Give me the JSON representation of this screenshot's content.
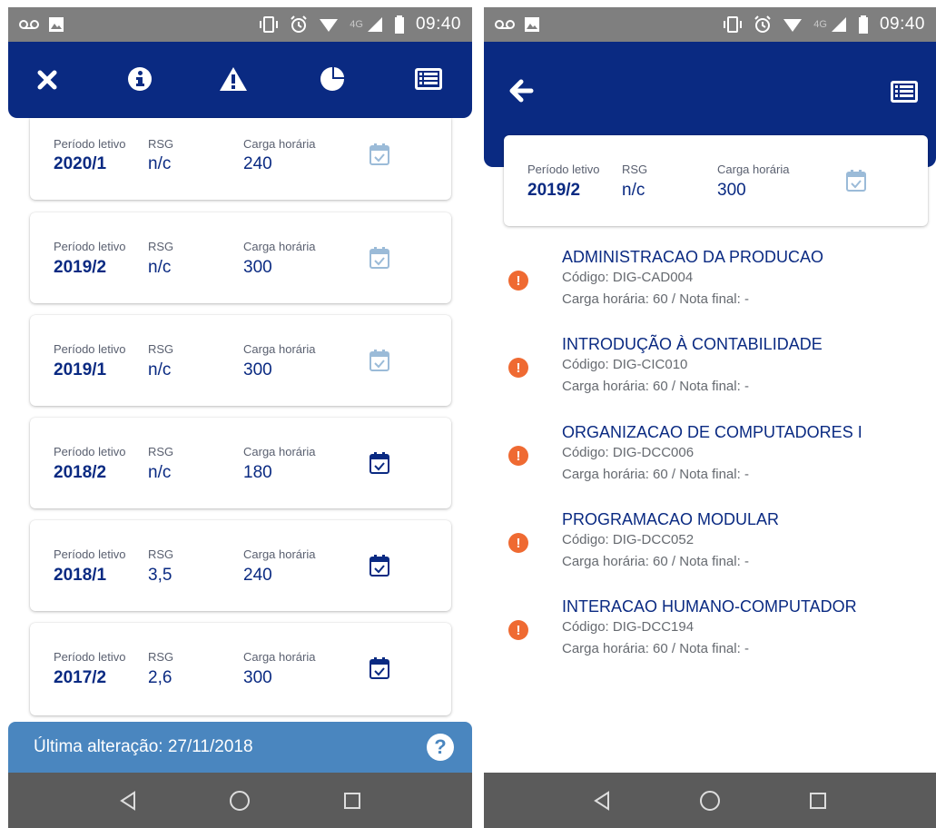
{
  "status_bar": {
    "time": "09:40",
    "network": "4G"
  },
  "colors": {
    "primary": "#0a2a82",
    "footer": "#4a86bf",
    "warning": "#ef6a32",
    "calendar_active": "#0a2a82",
    "calendar_inactive": "#9bbbd8"
  },
  "left_screen": {
    "toolbar": {
      "icons": [
        "close-icon",
        "info-icon",
        "warning-icon",
        "pie-chart-icon",
        "list-icon"
      ]
    },
    "labels": {
      "period": "Período letivo",
      "rsg": "RSG",
      "hours": "Carga horária"
    },
    "periods": [
      {
        "period": "2020/1",
        "rsg": "n/c",
        "hours": "240",
        "calendar_state": "inactive"
      },
      {
        "period": "2019/2",
        "rsg": "n/c",
        "hours": "300",
        "calendar_state": "inactive"
      },
      {
        "period": "2019/1",
        "rsg": "n/c",
        "hours": "300",
        "calendar_state": "inactive"
      },
      {
        "period": "2018/2",
        "rsg": "n/c",
        "hours": "180",
        "calendar_state": "active"
      },
      {
        "period": "2018/1",
        "rsg": "3,5",
        "hours": "240",
        "calendar_state": "active"
      },
      {
        "period": "2017/2",
        "rsg": "2,6",
        "hours": "300",
        "calendar_state": "active"
      }
    ],
    "footer": {
      "last_change": "Última alteração: 27/11/2018",
      "help_icon": "help-icon"
    }
  },
  "right_screen": {
    "toolbar": {
      "icons": [
        "back-arrow-icon",
        "list-icon"
      ]
    },
    "summary": {
      "period_label": "Período letivo",
      "period": "2019/2",
      "rsg_label": "RSG",
      "rsg": "n/c",
      "hours_label": "Carga horária",
      "hours": "300"
    },
    "subjects": [
      {
        "name": "ADMINISTRACAO DA PRODUCAO",
        "code": "Código: DIG-CAD004",
        "detail": "Carga horária: 60 / Nota final: -"
      },
      {
        "name": "INTRODUÇÃO À CONTABILIDADE",
        "code": "Código: DIG-CIC010",
        "detail": "Carga horária: 60 / Nota final: -"
      },
      {
        "name": "ORGANIZACAO DE COMPUTADORES I",
        "code": "Código: DIG-DCC006",
        "detail": "Carga horária: 60 / Nota final: -"
      },
      {
        "name": "PROGRAMACAO MODULAR",
        "code": "Código: DIG-DCC052",
        "detail": "Carga horária: 60 / Nota final: -"
      },
      {
        "name": "INTERACAO HUMANO-COMPUTADOR",
        "code": "Código: DIG-DCC194",
        "detail": "Carga horária: 60 / Nota final: -"
      }
    ]
  },
  "nav_bar": {
    "icons": [
      "back-triangle-icon",
      "home-circle-icon",
      "recents-square-icon"
    ]
  }
}
